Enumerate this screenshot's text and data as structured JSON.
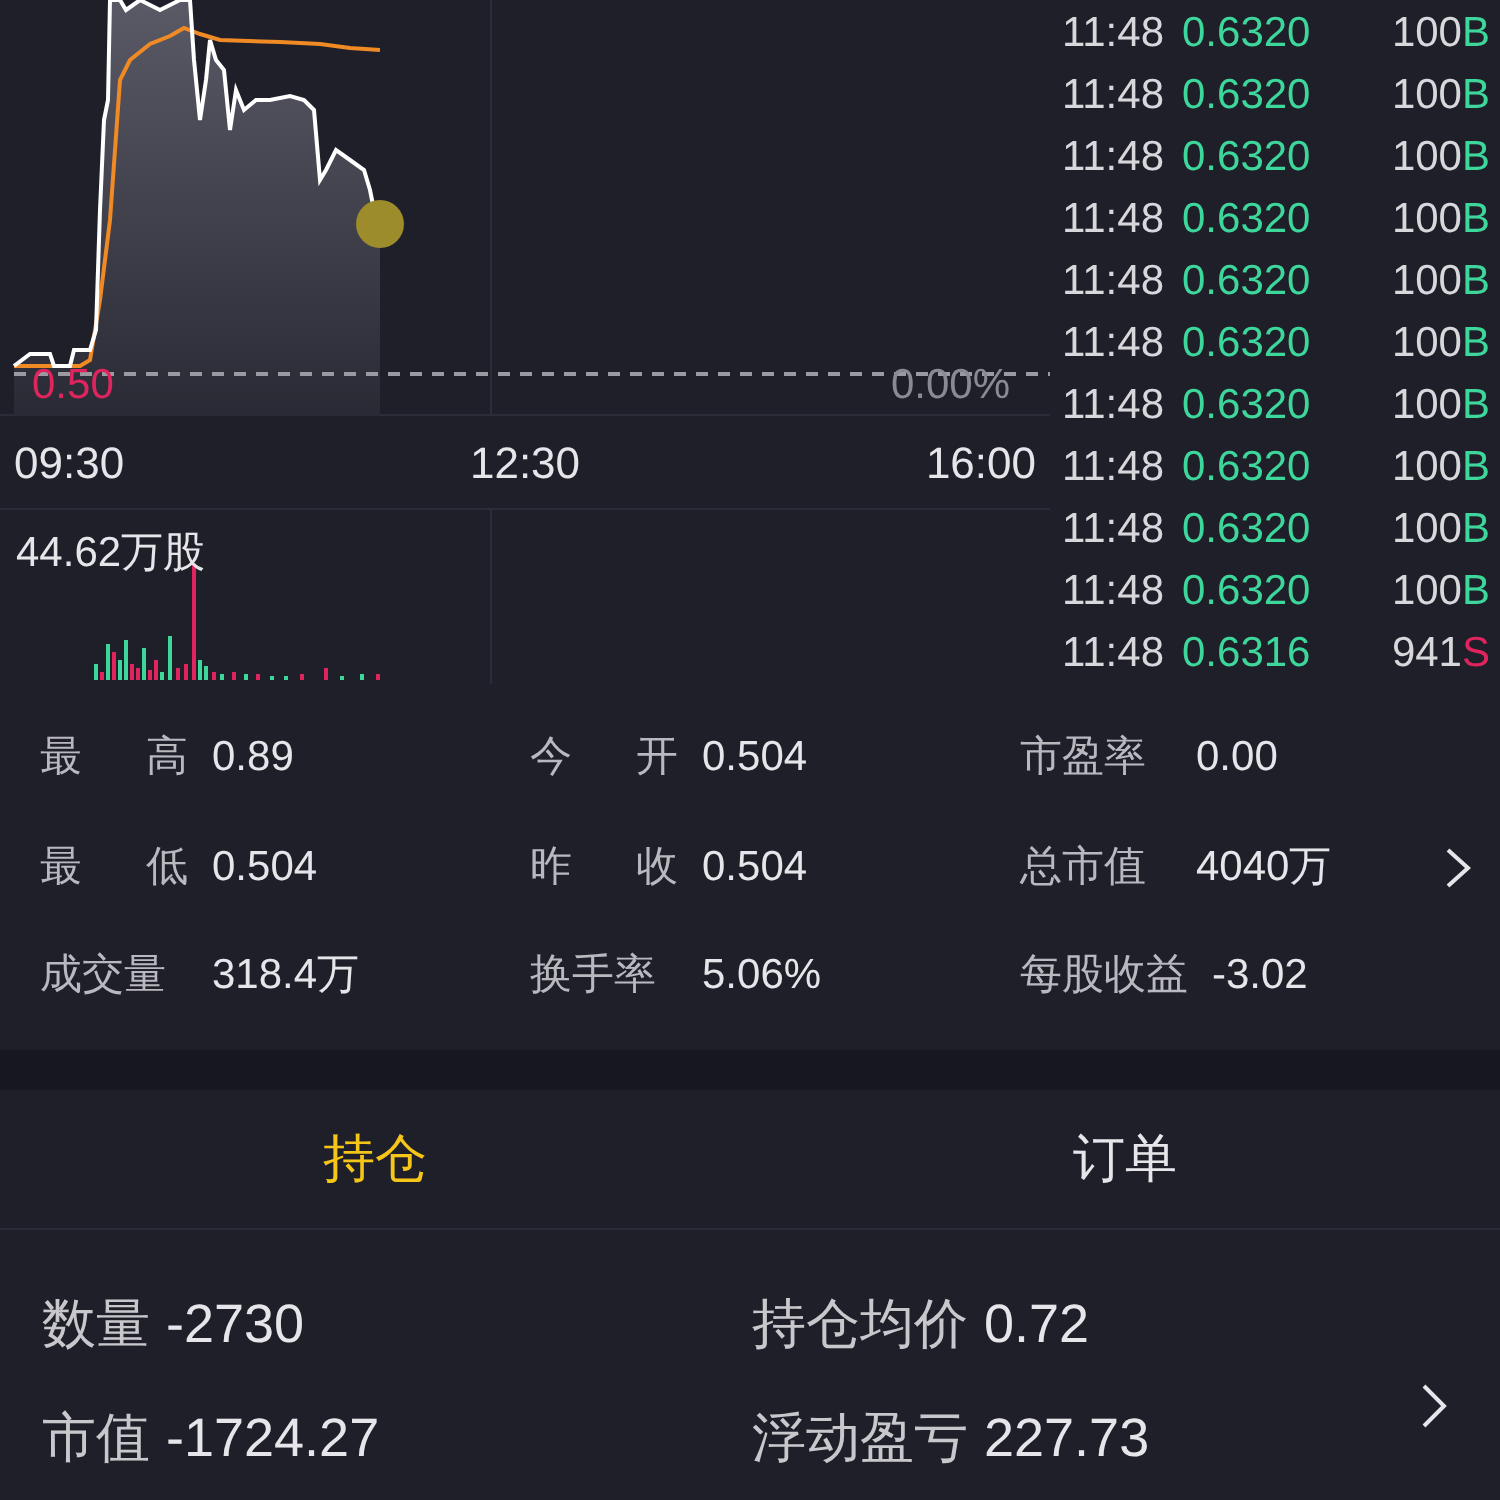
{
  "chart": {
    "price_label": "0.50",
    "change_label": "0.00%",
    "times": [
      "09:30",
      "12:30",
      "16:00"
    ],
    "volume_label": "44.62万股"
  },
  "trades": [
    {
      "time": "11:48",
      "price": "0.6320",
      "volume": "100",
      "side": "B",
      "kind": "buy"
    },
    {
      "time": "11:48",
      "price": "0.6320",
      "volume": "100",
      "side": "B",
      "kind": "buy"
    },
    {
      "time": "11:48",
      "price": "0.6320",
      "volume": "100",
      "side": "B",
      "kind": "buy"
    },
    {
      "time": "11:48",
      "price": "0.6320",
      "volume": "100",
      "side": "B",
      "kind": "buy"
    },
    {
      "time": "11:48",
      "price": "0.6320",
      "volume": "100",
      "side": "B",
      "kind": "buy"
    },
    {
      "time": "11:48",
      "price": "0.6320",
      "volume": "100",
      "side": "B",
      "kind": "buy"
    },
    {
      "time": "11:48",
      "price": "0.6320",
      "volume": "100",
      "side": "B",
      "kind": "buy"
    },
    {
      "time": "11:48",
      "price": "0.6320",
      "volume": "100",
      "side": "B",
      "kind": "buy"
    },
    {
      "time": "11:48",
      "price": "0.6320",
      "volume": "100",
      "side": "B",
      "kind": "buy"
    },
    {
      "time": "11:48",
      "price": "0.6320",
      "volume": "100",
      "side": "B",
      "kind": "buy"
    },
    {
      "time": "11:48",
      "price": "0.6316",
      "volume": "941",
      "side": "S",
      "kind": "sell"
    }
  ],
  "stats": [
    {
      "label": "最 高",
      "value": "0.89"
    },
    {
      "label": "今 开",
      "value": "0.504"
    },
    {
      "label": "市盈率",
      "value": "0.00"
    },
    {
      "label": "最 低",
      "value": "0.504"
    },
    {
      "label": "昨 收",
      "value": "0.504"
    },
    {
      "label": "总市值",
      "value": "4040万"
    },
    {
      "label": "成交量",
      "value": "318.4万"
    },
    {
      "label": "换手率",
      "value": "5.06%"
    },
    {
      "label": "每股收益",
      "value": "-3.02"
    }
  ],
  "tabs": [
    {
      "label": "持仓",
      "selected": true
    },
    {
      "label": "订单",
      "selected": false
    }
  ],
  "position": [
    {
      "label": "数量",
      "value": "-2730"
    },
    {
      "label": "持仓均价",
      "value": "0.72"
    },
    {
      "label": "市值",
      "value": "-1724.27"
    },
    {
      "label": "浮动盈亏",
      "value": "227.73"
    }
  ]
}
